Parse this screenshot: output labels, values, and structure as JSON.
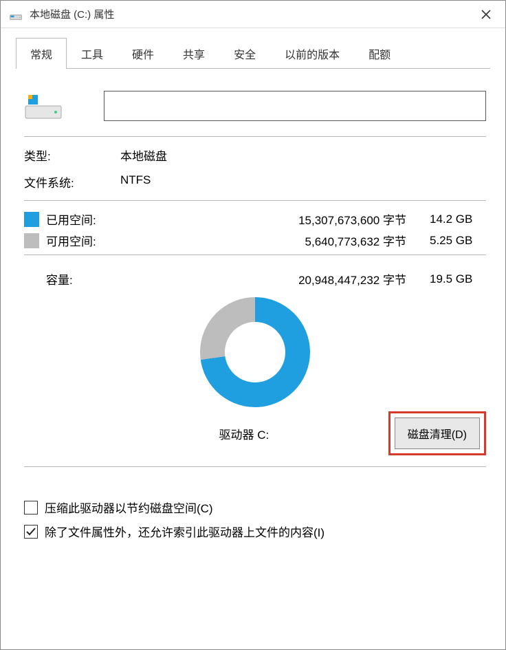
{
  "window": {
    "title": "本地磁盘 (C:) 属性"
  },
  "tabs": [
    {
      "label": "常规"
    },
    {
      "label": "工具"
    },
    {
      "label": "硬件"
    },
    {
      "label": "共享"
    },
    {
      "label": "安全"
    },
    {
      "label": "以前的版本"
    },
    {
      "label": "配额"
    }
  ],
  "drive_name_value": "",
  "fields": {
    "type_label": "类型:",
    "type_value": "本地磁盘",
    "fs_label": "文件系统:",
    "fs_value": "NTFS"
  },
  "space": {
    "used_label": "已用空间:",
    "used_bytes": "15,307,673,600 字节",
    "used_gb": "14.2 GB",
    "free_label": "可用空间:",
    "free_bytes": "5,640,773,632 字节",
    "free_gb": "5.25 GB",
    "cap_label": "容量:",
    "cap_bytes": "20,948,447,232 字节",
    "cap_gb": "19.5 GB"
  },
  "drive_label": "驱动器 C:",
  "disk_cleanup": "磁盘清理(D)",
  "checkbox1": "压缩此驱动器以节约磁盘空间(C)",
  "checkbox2": "除了文件属性外，还允许索引此驱动器上文件的内容(I)",
  "colors": {
    "used": "#1f9fe0",
    "free": "#bdbdbd",
    "highlight_border": "#d53a2b"
  },
  "chart_data": {
    "type": "pie",
    "title": "驱动器 C:",
    "series": [
      {
        "name": "已用空间",
        "value": 15307673600,
        "display": "14.2 GB",
        "color": "#1f9fe0"
      },
      {
        "name": "可用空间",
        "value": 5640773632,
        "display": "5.25 GB",
        "color": "#bdbdbd"
      }
    ],
    "total": {
      "label": "容量",
      "value": 20948447232,
      "display": "19.5 GB"
    }
  }
}
